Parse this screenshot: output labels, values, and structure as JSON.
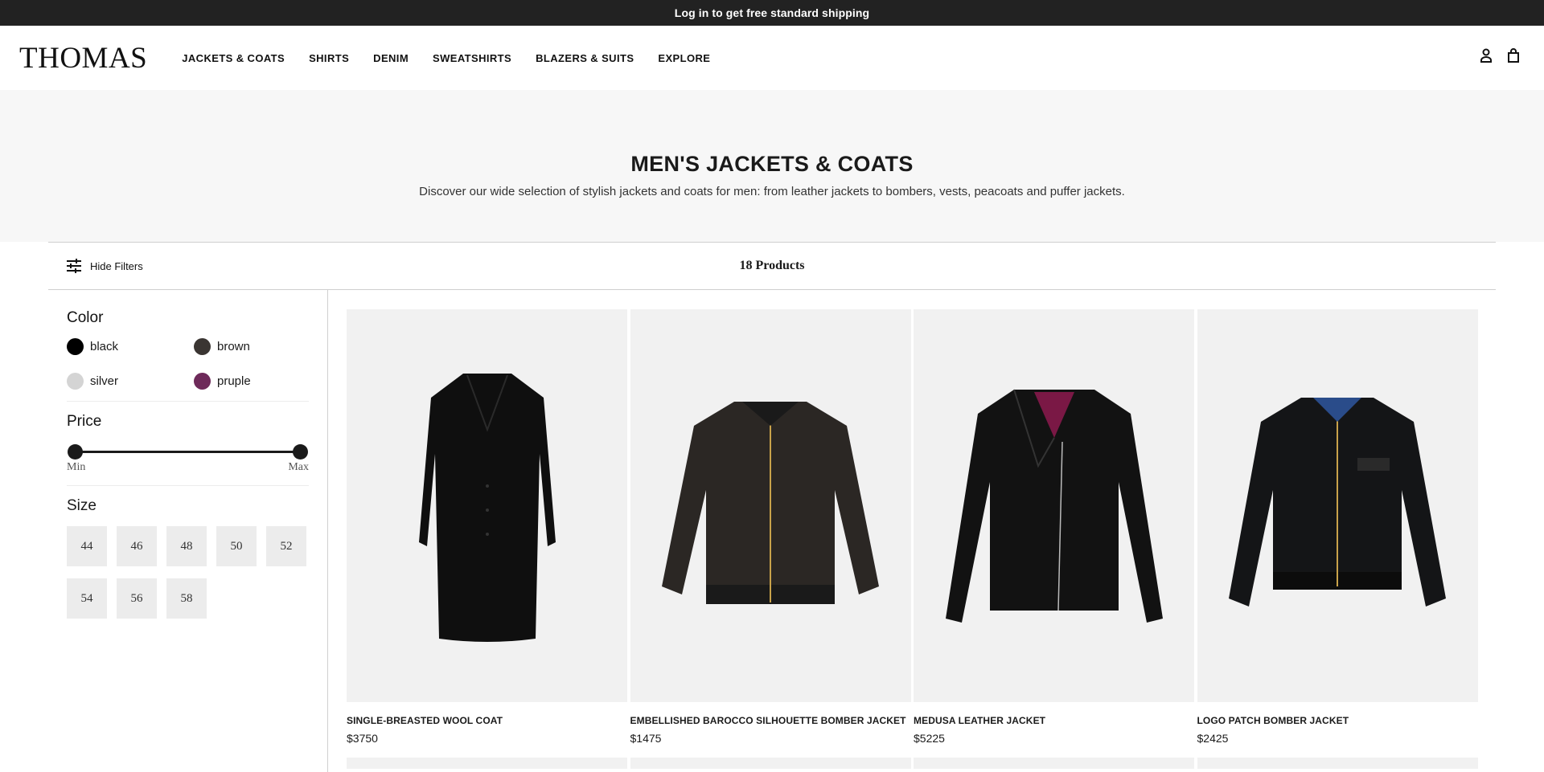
{
  "announcement": "Log in to get free standard shipping",
  "brand": "THOMAS",
  "nav": [
    "JACKETS & COATS",
    "SHIRTS",
    "DENIM",
    "SWEATSHIRTS",
    "BLAZERS & SUITS",
    "EXPLORE"
  ],
  "header_icons": [
    "account-icon",
    "shopping-bag-icon"
  ],
  "hero": {
    "title": "MEN'S JACKETS & COATS",
    "subtitle": "Discover our wide selection of stylish jackets and coats for men: from leather jackets to bombers, vests, peacoats and puffer jackets."
  },
  "toolbar": {
    "hide_filters": "Hide Filters",
    "product_count": "18 Products"
  },
  "filters": {
    "color_title": "Color",
    "colors": [
      {
        "label": "black",
        "hex": "#000000"
      },
      {
        "label": "brown",
        "hex": "#3a3532"
      },
      {
        "label": "silver",
        "hex": "#d4d4d4"
      },
      {
        "label": "pruple",
        "hex": "#6e2a5a"
      }
    ],
    "price_title": "Price",
    "price_min_label": "Min",
    "price_max_label": "Max",
    "size_title": "Size",
    "sizes": [
      "44",
      "46",
      "48",
      "50",
      "52",
      "54",
      "56",
      "58"
    ]
  },
  "products": [
    {
      "name": "SINGLE-BREASTED WOOL COAT",
      "price": "$3750"
    },
    {
      "name": "EMBELLISHED BAROCCO SILHOUETTE BOMBER JACKET",
      "price": "$1475"
    },
    {
      "name": "MEDUSA LEATHER JACKET",
      "price": "$5225"
    },
    {
      "name": "LOGO PATCH BOMBER JACKET",
      "price": "$2425"
    }
  ]
}
